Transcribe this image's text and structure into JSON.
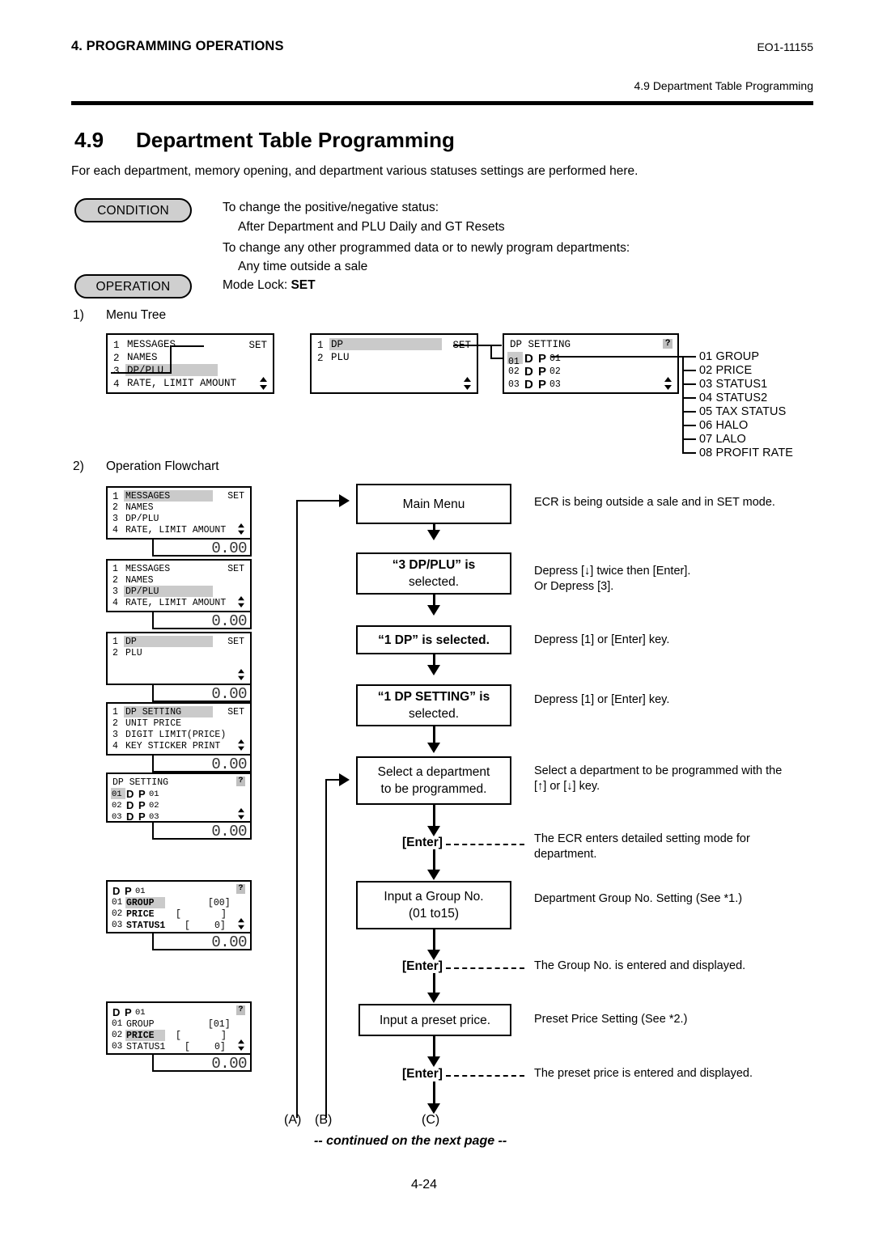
{
  "header": {
    "chapter": "4. PROGRAMMING OPERATIONS",
    "doc_code": "EO1-11155",
    "running_head": "4.9 Department Table Programming"
  },
  "section": {
    "number": "4.9",
    "title": "Department Table Programming",
    "intro": "For each department, memory opening, and department various statuses settings are performed here."
  },
  "condition_block": {
    "condition_label": "CONDITION",
    "operation_label": "OPERATION",
    "lines": [
      "To change the positive/negative status:",
      "After Department and PLU Daily and GT Resets",
      "To change any other programmed data or to newly program departments:",
      "Any time outside a sale"
    ],
    "mode_lock_prefix": "Mode Lock: ",
    "mode_lock_value": "SET"
  },
  "subheads": {
    "menu_tree_num": "1)",
    "menu_tree_label": "Menu Tree",
    "flowchart_num": "2)",
    "flowchart_label": "Operation Flowchart"
  },
  "menu_tree": {
    "screen1": {
      "rows": [
        {
          "idx": "1",
          "text": "MESSAGES",
          "highlight": false
        },
        {
          "idx": "2",
          "text": "NAMES",
          "highlight": false
        },
        {
          "idx": "3",
          "text": "DP/PLU",
          "highlight": true
        },
        {
          "idx": "4",
          "text": "RATE, LIMIT AMOUNT",
          "highlight": false
        }
      ],
      "corner": "SET"
    },
    "screen2": {
      "rows": [
        {
          "idx": "1",
          "text": "DP",
          "highlight": true
        },
        {
          "idx": "2",
          "text": "PLU",
          "highlight": false
        }
      ],
      "corner": "SET"
    },
    "screen3": {
      "title": "DP SETTING",
      "corner": "?",
      "rows": [
        {
          "idx": "01",
          "text": "D P",
          "suffix": "01",
          "highlight": true
        },
        {
          "idx": "02",
          "text": "D P",
          "suffix": "02",
          "highlight": false
        },
        {
          "idx": "03",
          "text": "D P",
          "suffix": "03",
          "highlight": false
        }
      ]
    },
    "branches": [
      "01 GROUP",
      "02 PRICE",
      "03 STATUS1",
      "04 STATUS2",
      "05 TAX STATUS",
      "06 HALO",
      "07 LALO",
      "08 PROFIT RATE"
    ]
  },
  "lcd_panels": [
    {
      "name": "main-menu",
      "corner": "SET",
      "subtotal": "0.00",
      "rows": [
        {
          "idx": "1",
          "text": "MESSAGES",
          "highlight": true
        },
        {
          "idx": "2",
          "text": "NAMES",
          "highlight": false
        },
        {
          "idx": "3",
          "text": "DP/PLU",
          "highlight": false
        },
        {
          "idx": "4",
          "text": "RATE, LIMIT AMOUNT",
          "highlight": false
        }
      ]
    },
    {
      "name": "dp-plu-selected",
      "corner": "SET",
      "subtotal": "0.00",
      "rows": [
        {
          "idx": "1",
          "text": "MESSAGES",
          "highlight": false
        },
        {
          "idx": "2",
          "text": "NAMES",
          "highlight": false
        },
        {
          "idx": "3",
          "text": "DP/PLU",
          "highlight": true
        },
        {
          "idx": "4",
          "text": "RATE, LIMIT AMOUNT",
          "highlight": false
        }
      ]
    },
    {
      "name": "dp-selected",
      "corner": "SET",
      "subtotal": "0.00",
      "rows": [
        {
          "idx": "1",
          "text": "DP",
          "highlight": true
        },
        {
          "idx": "2",
          "text": "PLU",
          "highlight": false
        }
      ]
    },
    {
      "name": "dp-setting-selected",
      "corner": "SET",
      "subtotal": "0.00",
      "rows": [
        {
          "idx": "1",
          "text": "DP SETTING",
          "highlight": true
        },
        {
          "idx": "2",
          "text": "UNIT PRICE",
          "highlight": false
        },
        {
          "idx": "3",
          "text": "DIGIT LIMIT(PRICE)",
          "highlight": false
        },
        {
          "idx": "4",
          "text": "KEY STICKER PRINT",
          "highlight": false
        }
      ]
    }
  ],
  "lcd_dp_list": {
    "title": "DP SETTING",
    "corner": "?",
    "subtotal": "0.00",
    "rows": [
      {
        "idx": "01",
        "text": "D P",
        "suffix": "01",
        "highlight": true
      },
      {
        "idx": "02",
        "text": "D P",
        "suffix": "02",
        "highlight": false
      },
      {
        "idx": "03",
        "text": "D P",
        "suffix": "03",
        "highlight": false
      }
    ]
  },
  "lcd_detail_group": {
    "title": "D P",
    "title_suffix": "01",
    "corner": "?",
    "subtotal": "0.00",
    "rows": [
      {
        "idx": "01",
        "label": "GROUP",
        "value": "[00]",
        "highlight": true
      },
      {
        "idx": "02",
        "label": "PRICE",
        "bracket_open": "[",
        "bracket_close": "]",
        "highlight": false
      },
      {
        "idx": "03",
        "label": "STATUS1",
        "bracket_open": "[",
        "value2": "0]",
        "highlight": false
      }
    ]
  },
  "lcd_detail_price": {
    "title": "D P",
    "title_suffix": "01",
    "corner": "?",
    "subtotal": "0.00",
    "rows": [
      {
        "idx": "01",
        "label": "GROUP",
        "value": "[01]",
        "highlight": false
      },
      {
        "idx": "02",
        "label": "PRICE",
        "bracket_open": "[",
        "bracket_close": "]",
        "highlight": true
      },
      {
        "idx": "03",
        "label": "STATUS1",
        "bracket_open": "[",
        "value2": "0]",
        "highlight": false
      }
    ]
  },
  "flow": {
    "box_main_menu": "Main Menu",
    "box_dpplu_a": "“3 DP/PLU” is",
    "box_dpplu_b": "selected.",
    "box_dp": "“1 DP” is selected.",
    "box_dpsetting_a": "“1 DP SETTING” is",
    "box_dpsetting_b": "selected.",
    "box_select_a": "Select a department",
    "box_select_b": "to be programmed.",
    "box_group_a": "Input a Group No.",
    "box_group_b": "(01 to15)",
    "box_price": "Input a preset price.",
    "enter_label": "[Enter]"
  },
  "notes": {
    "n1": "ECR is being outside a sale and in SET mode.",
    "n2a": "Depress [↓] twice then [Enter].",
    "n2b": "Or Depress [3].",
    "n3": "Depress [1] or [Enter] key.",
    "n4": "Depress [1] or [Enter] key.",
    "n5a": "Select a department to be programmed with the",
    "n5b": "[↑] or [↓] key.",
    "n6a": "The ECR enters detailed setting mode for",
    "n6b": "department.",
    "n7": "Department Group No. Setting (See *1.)",
    "n8": "The Group No. is entered and displayed.",
    "n9": "Preset Price Setting (See *2.)",
    "n10": "The preset price is entered and displayed."
  },
  "connectors": {
    "a": "(A)",
    "b": "(B)",
    "c": "(C)"
  },
  "footer": {
    "continued": "-- continued on the next page  --",
    "page": "4-24"
  }
}
